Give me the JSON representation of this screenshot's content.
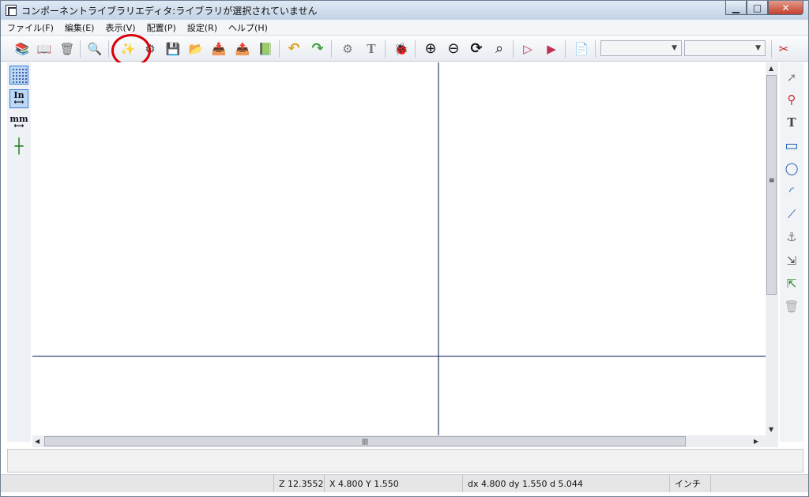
{
  "window": {
    "title": "コンポーネントライブラリエディタ:ライブラリが選択されていません",
    "controls": {
      "minimize": "▁",
      "maximize": "□",
      "close": "✕"
    }
  },
  "menubar": {
    "items": [
      {
        "name": "menu-file",
        "label": "ファイル(F)"
      },
      {
        "name": "menu-edit",
        "label": "編集(E)"
      },
      {
        "name": "menu-view",
        "label": "表示(V)"
      },
      {
        "name": "menu-place",
        "label": "配置(P)"
      },
      {
        "name": "menu-settings",
        "label": "設定(R)"
      },
      {
        "name": "menu-help",
        "label": "ヘルプ(H)"
      }
    ]
  },
  "toolbar": {
    "highlighted_tool": "new-component-button",
    "tools": [
      {
        "name": "select-library-button",
        "icon": "book-stack-icon",
        "glyph": "📚"
      },
      {
        "name": "open-library-button",
        "icon": "open-book-icon",
        "glyph": "📖"
      },
      {
        "name": "delete-library-button",
        "icon": "trash-icon",
        "glyph": "🗑"
      },
      {
        "name": "library-browser-button",
        "icon": "magnifier-book-icon",
        "glyph": "🔍"
      },
      {
        "name": "new-component-button",
        "icon": "new-component-icon",
        "glyph": "✨"
      },
      {
        "name": "load-component-button",
        "icon": "component-icon",
        "glyph": "⚙"
      },
      {
        "name": "save-component-button",
        "icon": "save-component-icon",
        "glyph": "💾"
      },
      {
        "name": "save-as-component-button",
        "icon": "save-as-icon",
        "glyph": "📂"
      },
      {
        "name": "import-component-button",
        "icon": "import-icon",
        "glyph": "📥"
      },
      {
        "name": "export-component-button",
        "icon": "export-icon",
        "glyph": "📤"
      },
      {
        "name": "create-library-button",
        "icon": "new-library-icon",
        "glyph": "📗"
      },
      {
        "name": "undo-button",
        "icon": "undo-icon",
        "glyph": "↶"
      },
      {
        "name": "redo-button",
        "icon": "redo-icon",
        "glyph": "↷"
      },
      {
        "name": "component-properties-button",
        "icon": "properties-icon",
        "glyph": "⚙"
      },
      {
        "name": "edit-fields-button",
        "icon": "text-icon",
        "glyph": "T"
      },
      {
        "name": "check-pins-button",
        "icon": "bug-icon",
        "glyph": "🐞"
      },
      {
        "name": "zoom-in-button",
        "icon": "zoom-in-icon",
        "glyph": "⊕"
      },
      {
        "name": "zoom-out-button",
        "icon": "zoom-out-icon",
        "glyph": "⊖"
      },
      {
        "name": "redraw-button",
        "icon": "refresh-icon",
        "glyph": "⟳"
      },
      {
        "name": "zoom-fit-button",
        "icon": "zoom-fit-icon",
        "glyph": "⌕"
      },
      {
        "name": "normal-body-button",
        "icon": "gate-icon",
        "glyph": "▷"
      },
      {
        "name": "demorgan-body-button",
        "icon": "demorgan-gate-icon",
        "glyph": "▶"
      },
      {
        "name": "datasheet-button",
        "icon": "pdf-icon",
        "glyph": "📄"
      },
      {
        "name": "edit-pins-per-part-button",
        "icon": "pins-icon",
        "glyph": "✂"
      }
    ],
    "unit_dropdown": {
      "value": ""
    },
    "alias_dropdown": {
      "value": ""
    }
  },
  "left_toolbar": {
    "tools": [
      {
        "name": "grid-toggle",
        "icon": "grid-icon",
        "label": "⋮⋮⋮",
        "active": true
      },
      {
        "name": "units-inch-button",
        "icon": "inch-units-icon",
        "label": "In",
        "active": true
      },
      {
        "name": "units-mm-button",
        "icon": "mm-units-icon",
        "label": "mm",
        "active": false
      },
      {
        "name": "cursor-shape-button",
        "icon": "crosshair-cursor-icon",
        "label": "┼",
        "active": false
      }
    ]
  },
  "right_toolbar": {
    "tools": [
      {
        "name": "select-tool",
        "icon": "arrow-cursor-icon",
        "glyph": "➚"
      },
      {
        "name": "add-pin-tool",
        "icon": "pin-icon",
        "glyph": "⚲"
      },
      {
        "name": "add-text-tool",
        "icon": "text-icon",
        "glyph": "T"
      },
      {
        "name": "add-rectangle-tool",
        "icon": "rectangle-icon",
        "glyph": "▭"
      },
      {
        "name": "add-circle-tool",
        "icon": "circle-icon",
        "glyph": "◯"
      },
      {
        "name": "add-arc-tool",
        "icon": "arc-icon",
        "glyph": "◜"
      },
      {
        "name": "add-polyline-tool",
        "icon": "polyline-icon",
        "glyph": "⟋"
      },
      {
        "name": "set-anchor-tool",
        "icon": "anchor-icon",
        "glyph": "⚓"
      },
      {
        "name": "import-graphic-tool",
        "icon": "import-icon",
        "glyph": "⇲"
      },
      {
        "name": "export-graphic-tool",
        "icon": "export-icon",
        "glyph": "⇱"
      },
      {
        "name": "delete-tool",
        "icon": "trash-icon",
        "glyph": "🗑"
      }
    ]
  },
  "scrollbars": {
    "vertical_grip": "≡",
    "horizontal_grip": "|||",
    "up": "▲",
    "down": "▼",
    "left": "◀",
    "right": "▶"
  },
  "status": {
    "zoom": "Z 12.3552",
    "position": "X 4.800  Y 1.550",
    "delta": "dx 4.800  dy 1.550  d 5.044",
    "units": "インチ"
  },
  "colors": {
    "axis_line": "#0a1a5c",
    "highlight_ring": "#d9000b",
    "canvas_bg": "#ffffff"
  }
}
